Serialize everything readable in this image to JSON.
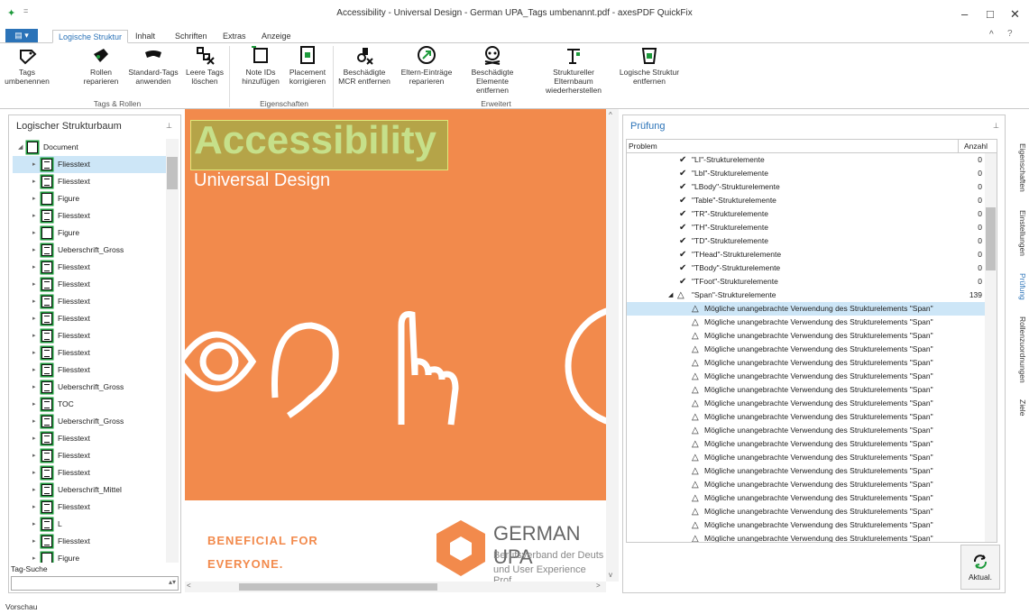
{
  "window": {
    "title": "Accessibility - Universal Design - German UPA_Tags umbenannt.pdf - axesPDF QuickFix",
    "min": "–",
    "max": "□",
    "close": "✕"
  },
  "tabs": [
    "Logische Struktur",
    "Inhalt",
    "Schriften",
    "Extras",
    "Anzeige"
  ],
  "ribbon": {
    "buttons": [
      {
        "label": "Tags umbenennen"
      },
      {
        "label": "Rollen reparieren"
      },
      {
        "label": "Standard-Tags anwenden"
      },
      {
        "label": "Leere Tags löschen"
      },
      {
        "label": "Note IDs hinzufügen"
      },
      {
        "label": "Placement korrigieren"
      },
      {
        "label": "Beschädigte MCR entfernen"
      },
      {
        "label": "Eltern-Einträge reparieren"
      },
      {
        "label": "Beschädigte Elemente entfernen"
      },
      {
        "label": "Struktureller Elternbaum wiederherstellen"
      },
      {
        "label": "Logische Struktur entfernen"
      }
    ],
    "groups": [
      "Tags & Rollen",
      "Eigenschaften",
      "Erweitert"
    ]
  },
  "left": {
    "title": "Logischer Strukturbaum",
    "tag_search": "Tag-Suche",
    "tree": [
      "Document",
      "Fliesstext",
      "Fliesstext",
      "Figure",
      "Fliesstext",
      "Figure",
      "Ueberschrift_Gross",
      "Fliesstext",
      "Fliesstext",
      "Fliesstext",
      "Fliesstext",
      "Fliesstext",
      "Fliesstext",
      "Fliesstext",
      "Ueberschrift_Gross",
      "TOC",
      "Ueberschrift_Gross",
      "Fliesstext",
      "Fliesstext",
      "Fliesstext",
      "Ueberschrift_Mittel",
      "Fliesstext",
      "L",
      "Fliesstext",
      "Figure"
    ]
  },
  "preview": {
    "title": "Accessibility",
    "subtitle": "Universal Design",
    "beneficial1": "BENEFICIAL FOR",
    "beneficial2": "EVERYONE.",
    "org": "GERMAN UPA",
    "org_sub1": "Berufsverband der Deuts",
    "org_sub2": "und User Experience Prof"
  },
  "right": {
    "title": "Prüfung",
    "col_problem": "Problem",
    "col_count": "Anzahl",
    "rows": [
      {
        "text": "\"LI\"-Strukturelemente",
        "count": "0",
        "type": "check"
      },
      {
        "text": "\"Lbl\"-Strukturelemente",
        "count": "0",
        "type": "check"
      },
      {
        "text": "\"LBody\"-Strukturelemente",
        "count": "0",
        "type": "check"
      },
      {
        "text": "\"Table\"-Strukturelemente",
        "count": "0",
        "type": "check"
      },
      {
        "text": "\"TR\"-Strukturelemente",
        "count": "0",
        "type": "check"
      },
      {
        "text": "\"TH\"-Strukturelemente",
        "count": "0",
        "type": "check"
      },
      {
        "text": "\"TD\"-Strukturelemente",
        "count": "0",
        "type": "check"
      },
      {
        "text": "\"THead\"-Strukturelemente",
        "count": "0",
        "type": "check"
      },
      {
        "text": "\"TBody\"-Strukturelemente",
        "count": "0",
        "type": "check"
      },
      {
        "text": "\"TFoot\"-Strukturelemente",
        "count": "0",
        "type": "check"
      },
      {
        "text": "\"Span\"-Strukturelemente",
        "count": "139",
        "type": "warnparent"
      }
    ],
    "warning": "Mögliche unangebrachte Verwendung des Strukturelements \"Span\"",
    "aktual": "Aktual."
  },
  "side_tabs": [
    "Eigenschaften",
    "Einstellungen",
    "Prüfung",
    "Rollenzuordnungen",
    "Ziele"
  ],
  "status": "Vorschau"
}
